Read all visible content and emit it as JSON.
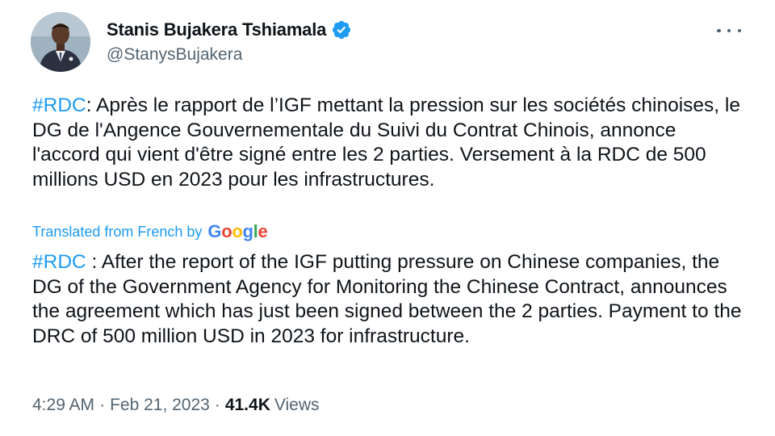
{
  "author": {
    "display_name": "Stanis Bujakera Tshiamala",
    "handle": "@StanysBujakera",
    "verified": true,
    "verified_icon": "verified-badge-icon",
    "avatar_icon": "profile-photo"
  },
  "menu": {
    "icon": "more-options-icon"
  },
  "tweet": {
    "hashtag": "#RDC",
    "text": ": Après le rapport de l’IGF mettant la pression sur les sociétés chinoises, le DG de l'Angence Gouvernementale du Suivi du Contrat Chinois, annonce l'accord qui vient d'être signé entre les 2 parties. Versement à la RDC de 500 millions USD en 2023 pour les infrastructures."
  },
  "translation": {
    "label": "Translated from French by",
    "provider": "Google",
    "hashtag": "#RDC",
    "text": " : After the report of the IGF putting pressure on Chinese companies, the DG of the Government Agency for Monitoring the Chinese Contract, announces the agreement which has just been signed between the 2 parties. Payment to the DRC of 500 million USD in 2023 for infrastructure."
  },
  "meta": {
    "time": "4:29 AM",
    "separator": "·",
    "date": "Feb 21, 2023",
    "views_count": "41.4K",
    "views_label": "Views"
  },
  "colors": {
    "accent": "#1d9bf0",
    "text": "#0f1419",
    "secondary_text": "#536471"
  }
}
